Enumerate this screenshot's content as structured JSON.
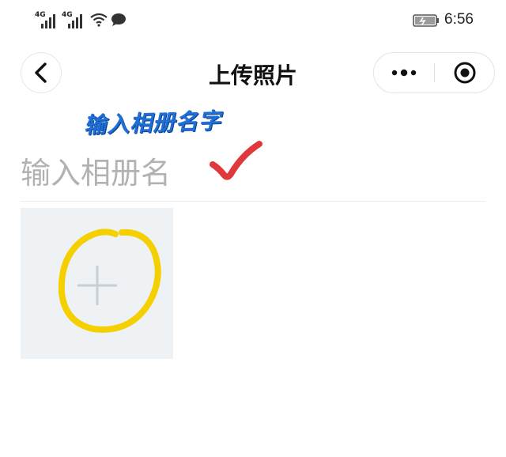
{
  "status_bar": {
    "signal1_label": "4G",
    "signal2_label": "4G",
    "time": "6:56",
    "icons": [
      "signal-icon",
      "signal-icon",
      "wifi-icon",
      "chat-icon",
      "battery-icon"
    ]
  },
  "nav": {
    "title": "上传照片",
    "back_icon": "chevron-left-icon",
    "more_icon": "more-dots-icon",
    "close_icon": "target-circle-icon"
  },
  "annotation": {
    "text": "输入相册名字",
    "color": "#1f6fd8",
    "check_color": "#e0393b",
    "highlight_color": "#f5d000"
  },
  "form": {
    "album_name_value": "",
    "album_name_placeholder": "输入相册名"
  },
  "upload": {
    "icon": "plus-icon",
    "tile_color": "#eef2f5"
  }
}
